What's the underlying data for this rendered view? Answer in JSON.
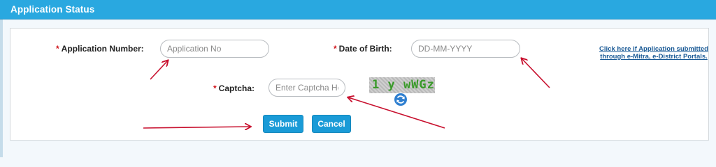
{
  "header": {
    "title": "Application Status"
  },
  "form": {
    "application_number": {
      "required_mark": "*",
      "label": "Application Number:",
      "placeholder": "Application No",
      "value": ""
    },
    "date_of_birth": {
      "required_mark": "*",
      "label": "Date of Birth:",
      "placeholder": "DD-MM-YYYY",
      "value": ""
    },
    "captcha": {
      "required_mark": "*",
      "label": "Captcha:",
      "placeholder": "Enter Captcha Here",
      "value": "",
      "image_text": "1 y wWGz"
    },
    "emitra_link": {
      "line1": "Click here if Application submitted",
      "line2": "through e-Mitra, e-District Portals."
    },
    "submit_label": "Submit",
    "cancel_label": "Cancel"
  },
  "icons": {
    "refresh": "refresh-icon",
    "annotation": "red-arrow"
  },
  "colors": {
    "header_bg": "#29a8e0",
    "button_bg": "#1a9bd7",
    "required": "#d0141a",
    "link": "#1a5a96",
    "annotation_arrow": "#c8102e",
    "captcha_text": "#3a9a2a"
  }
}
